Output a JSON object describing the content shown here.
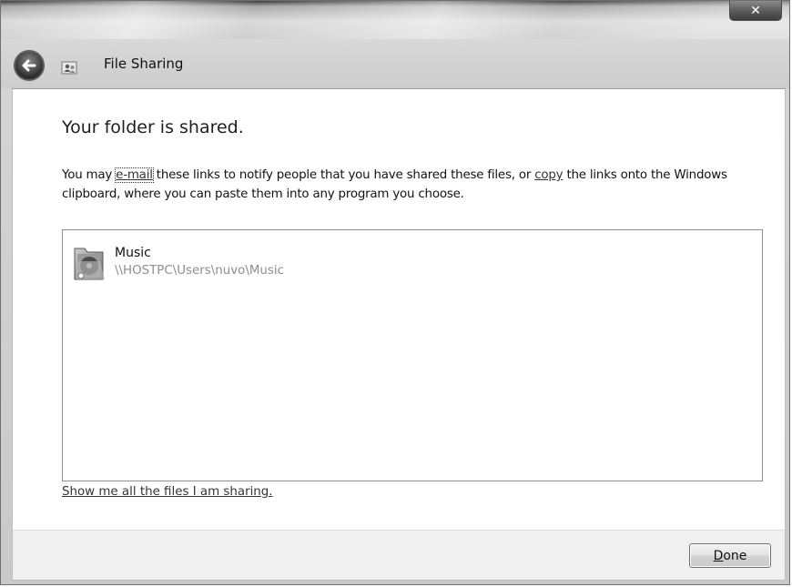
{
  "window": {
    "close_label": "✕"
  },
  "nav": {
    "title": "File Sharing",
    "back_icon": "back-arrow-icon",
    "app_icon": "file-sharing-icon"
  },
  "main": {
    "heading": "Your folder is shared.",
    "desc_part1": "You may ",
    "email_link": "e-mail",
    "desc_part2": " these links to notify people that you have shared these files, or ",
    "copy_link": "copy",
    "desc_part3": " the links onto the Windows clipboard, where you can paste them into any program you choose."
  },
  "shared_items": [
    {
      "name": "Music",
      "path": "\\\\HOSTPC\\Users\\nuvo\\Music",
      "icon": "music-folder-icon"
    }
  ],
  "show_link": "Show me all the files I am sharing.",
  "footer": {
    "done_mnemonic": "D",
    "done_rest": "one"
  }
}
